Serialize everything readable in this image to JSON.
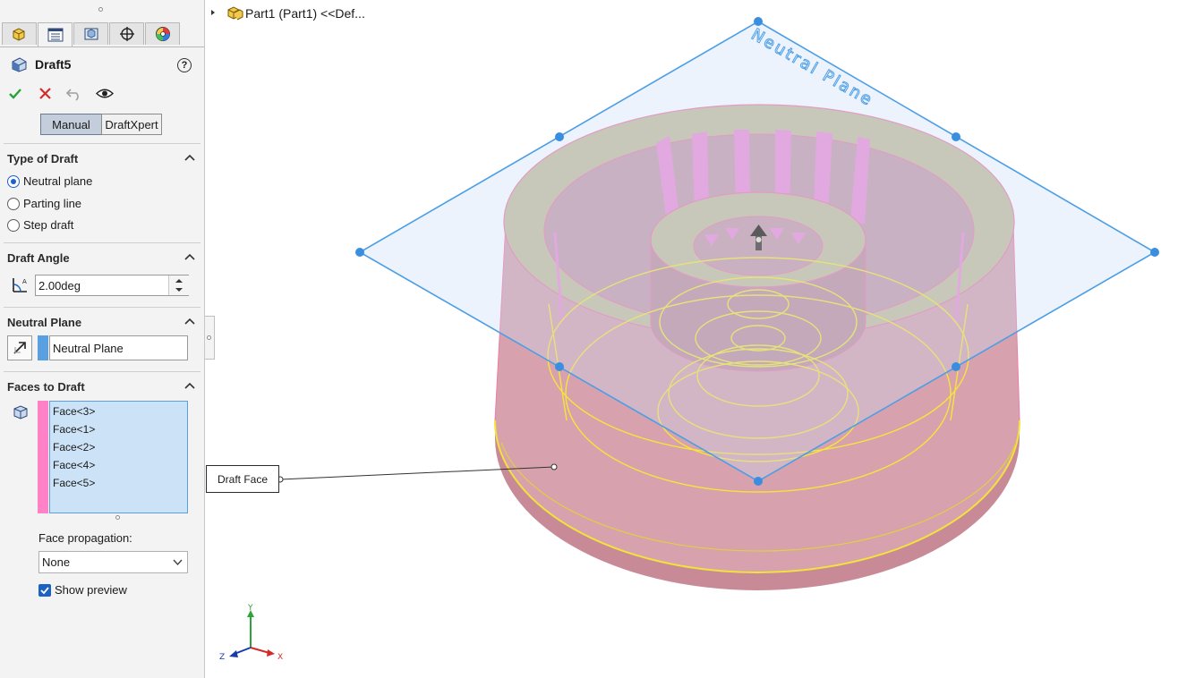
{
  "feature": {
    "title": "Draft5",
    "help_glyph": "?"
  },
  "tabs": [
    {
      "name": "featuremanager-tab",
      "icon": "part-icon"
    },
    {
      "name": "propertymanager-tab",
      "icon": "list-icon"
    },
    {
      "name": "configurationmanager-tab",
      "icon": "config-icon"
    },
    {
      "name": "dimxpert-tab",
      "icon": "crosshair-icon"
    },
    {
      "name": "display-manager-tab",
      "icon": "appearance-icon"
    }
  ],
  "modes": {
    "manual": "Manual",
    "draftxpert": "DraftXpert",
    "active": "manual"
  },
  "type_of_draft": {
    "title": "Type of Draft",
    "options": [
      "Neutral plane",
      "Parting line",
      "Step draft"
    ],
    "selected": "Neutral plane"
  },
  "draft_angle": {
    "title": "Draft Angle",
    "value": "2.00deg"
  },
  "neutral_plane": {
    "title": "Neutral Plane",
    "value": "Neutral Plane",
    "color": "#5aa0e0"
  },
  "faces_to_draft": {
    "title": "Faces to Draft",
    "faces": [
      "Face<3>",
      "Face<1>",
      "Face<2>",
      "Face<4>",
      "Face<5>"
    ],
    "color": "#ff82c6"
  },
  "face_propagation": {
    "label": "Face propagation:",
    "value": "None"
  },
  "show_preview": {
    "label": "Show preview",
    "checked": true
  },
  "tree": {
    "node": "Part1 (Part1) <<Def..."
  },
  "viewport": {
    "plane_label": "Neutral Plane",
    "callout": "Draft Face",
    "triad": {
      "x": "X",
      "y": "Y",
      "z": "Z"
    }
  },
  "colors": {
    "accent": "#1a62c4",
    "plane": "#4c9ee6",
    "part": "#d99aa8",
    "edges": "#f0e020"
  }
}
